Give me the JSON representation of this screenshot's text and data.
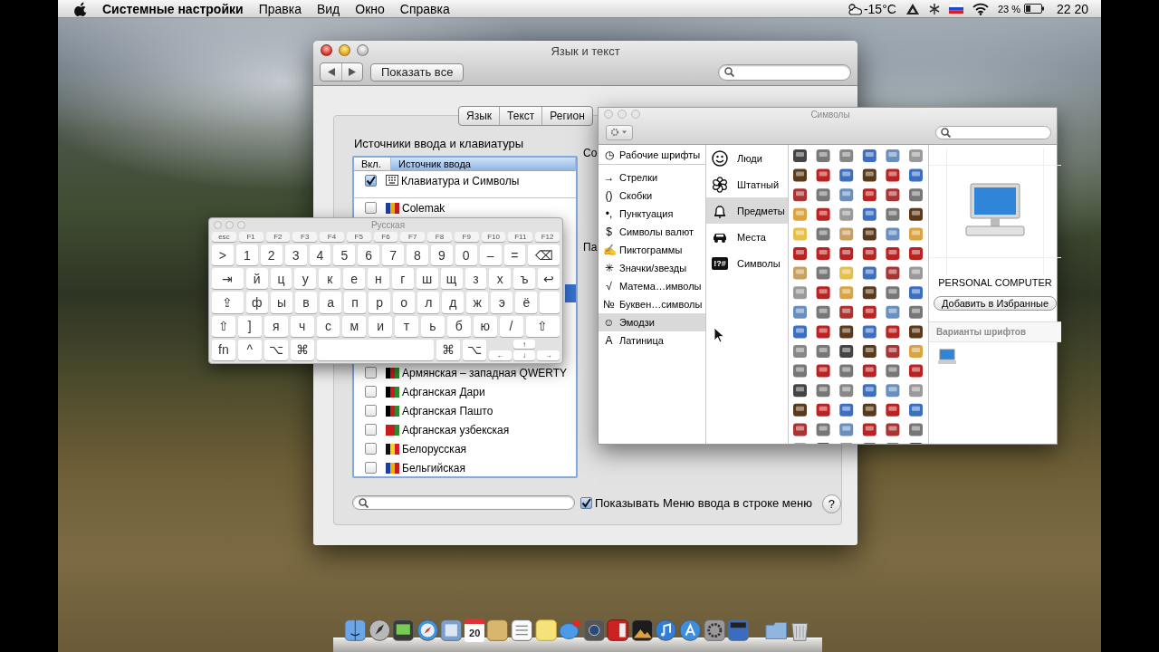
{
  "menubar": {
    "app": "Системные настройки",
    "menus": [
      "Правка",
      "Вид",
      "Окно",
      "Справка"
    ],
    "weather": "-15°C",
    "battery": "23 %",
    "clock": "22 20"
  },
  "prefs": {
    "title": "Язык и текст",
    "show_all": "Показать все",
    "tabs": [
      {
        "label": "Язык",
        "selected": false
      },
      {
        "label": "Текст",
        "selected": false
      },
      {
        "label": "Регион",
        "selected": false
      }
    ],
    "section": "Источники ввода и клавиатуры",
    "columns": [
      {
        "label": "Вкл.",
        "sorted": false
      },
      {
        "label": "Источник ввода",
        "sorted": true
      }
    ],
    "sources": [
      {
        "kind": "viewer",
        "label": "Клавиатура и Символы",
        "checked": true,
        "selected": false
      },
      {
        "kind": "layout",
        "label": "Colemak",
        "checked": false,
        "selected": false
      },
      {
        "kind": "covered",
        "selected": true
      },
      {
        "kind": "layout",
        "label": "Армянская – западная QWERTY",
        "checked": false,
        "selected": false
      },
      {
        "kind": "layout",
        "label": "Афганская Дари",
        "checked": false,
        "selected": false
      },
      {
        "kind": "layout",
        "label": "Афганская Пашто",
        "checked": false,
        "selected": false
      },
      {
        "kind": "layout",
        "label": "Афганская узбекская",
        "checked": false,
        "selected": false
      },
      {
        "kind": "layout",
        "label": "Белорусская",
        "checked": false,
        "selected": false
      },
      {
        "kind": "layout",
        "label": "Бельгийская",
        "checked": false,
        "selected": false
      }
    ],
    "column_2_texts": [
      "Со",
      "Па"
    ],
    "show_menu": {
      "label": "Показывать Меню ввода в строке меню",
      "checked": true
    },
    "help": "?"
  },
  "keyboard": {
    "title": "Русская",
    "rows": [
      [
        {
          "kind": "fn",
          "label": "esc"
        },
        {
          "kind": "fn",
          "label": "F1"
        },
        {
          "kind": "fn",
          "label": "F2"
        },
        {
          "kind": "fn",
          "label": "F3"
        },
        {
          "kind": "fn",
          "label": "F4"
        },
        {
          "kind": "fn",
          "label": "F5"
        },
        {
          "kind": "fn",
          "label": "F6"
        },
        {
          "kind": "fn",
          "label": "F7"
        },
        {
          "kind": "fn",
          "label": "F8"
        },
        {
          "kind": "fn",
          "label": "F9"
        },
        {
          "kind": "fn",
          "label": "F10"
        },
        {
          "kind": "fn",
          "label": "F11"
        },
        {
          "kind": "fn",
          "label": "F12"
        }
      ],
      [
        {
          "kind": "key",
          "label": ">"
        },
        {
          "kind": "key",
          "label": "1"
        },
        {
          "kind": "key",
          "label": "2"
        },
        {
          "kind": "key",
          "label": "3"
        },
        {
          "kind": "key",
          "label": "4"
        },
        {
          "kind": "key",
          "label": "5"
        },
        {
          "kind": "key",
          "label": "6"
        },
        {
          "kind": "key",
          "label": "7"
        },
        {
          "kind": "key",
          "label": "8"
        },
        {
          "kind": "key",
          "label": "9"
        },
        {
          "kind": "key",
          "label": "0"
        },
        {
          "kind": "key",
          "label": "–"
        },
        {
          "kind": "key",
          "label": "="
        },
        {
          "kind": "wide",
          "label": "⌫"
        }
      ],
      [
        {
          "kind": "wide",
          "label": "⇥"
        },
        {
          "kind": "key",
          "label": "й"
        },
        {
          "kind": "key",
          "label": "ц"
        },
        {
          "kind": "key",
          "label": "у"
        },
        {
          "kind": "key",
          "label": "к"
        },
        {
          "kind": "key",
          "label": "е"
        },
        {
          "kind": "key",
          "label": "н"
        },
        {
          "kind": "key",
          "label": "г"
        },
        {
          "kind": "key",
          "label": "ш"
        },
        {
          "kind": "key",
          "label": "щ"
        },
        {
          "kind": "key",
          "label": "з"
        },
        {
          "kind": "key",
          "label": "х"
        },
        {
          "kind": "key",
          "label": "ъ"
        },
        {
          "kind": "key",
          "label": "↩"
        }
      ],
      [
        {
          "kind": "wide",
          "label": "⇪"
        },
        {
          "kind": "key",
          "label": "ф"
        },
        {
          "kind": "key",
          "label": "ы"
        },
        {
          "kind": "key",
          "label": "в"
        },
        {
          "kind": "key",
          "label": "а"
        },
        {
          "kind": "key",
          "label": "п"
        },
        {
          "kind": "key",
          "label": "р"
        },
        {
          "kind": "key",
          "label": "о"
        },
        {
          "kind": "key",
          "label": "л"
        },
        {
          "kind": "key",
          "label": "д"
        },
        {
          "kind": "key",
          "label": "ж"
        },
        {
          "kind": "key",
          "label": "э"
        },
        {
          "kind": "key",
          "label": "ё"
        },
        {
          "kind": "space"
        }
      ],
      [
        {
          "kind": "key",
          "label": "⇧"
        },
        {
          "kind": "key",
          "label": "]"
        },
        {
          "kind": "key",
          "label": "я"
        },
        {
          "kind": "key",
          "label": "ч"
        },
        {
          "kind": "key",
          "label": "с"
        },
        {
          "kind": "key",
          "label": "м"
        },
        {
          "kind": "key",
          "label": "и"
        },
        {
          "kind": "key",
          "label": "т"
        },
        {
          "kind": "key",
          "label": "ь"
        },
        {
          "kind": "key",
          "label": "б"
        },
        {
          "kind": "key",
          "label": "ю"
        },
        {
          "kind": "key",
          "label": "/"
        },
        {
          "kind": "wide",
          "label": "⇧"
        }
      ],
      [
        {
          "kind": "key",
          "label": "fn"
        },
        {
          "kind": "key",
          "label": "^"
        },
        {
          "kind": "key",
          "label": "⌥"
        },
        {
          "kind": "key",
          "label": "⌘"
        },
        {
          "kind": "space"
        },
        {
          "kind": "key",
          "label": "⌘"
        },
        {
          "kind": "key",
          "label": "⌥"
        }
      ]
    ],
    "arrow_keys": [
      "↑",
      "←",
      "↓",
      "→"
    ]
  },
  "chars": {
    "title": "Символы",
    "categories": [
      {
        "glyph": "◷",
        "label": "Рабочие шрифты",
        "selected": false
      },
      {
        "glyph": "→",
        "label": "Стрелки",
        "selected": false
      },
      {
        "glyph": "()",
        "label": "Скобки",
        "selected": false
      },
      {
        "glyph": "•,",
        "label": "Пунктуация",
        "selected": false
      },
      {
        "glyph": "$",
        "label": "Символы валют",
        "selected": false
      },
      {
        "glyph": "✍",
        "label": "Пиктограммы",
        "selected": false
      },
      {
        "glyph": "✳",
        "label": "Значки/звезды",
        "selected": false
      },
      {
        "glyph": "√",
        "label": "Матема…имволы",
        "selected": false
      },
      {
        "glyph": "№",
        "label": "Буквен…символы",
        "selected": false
      },
      {
        "glyph": "☺",
        "label": "Эмодзи",
        "selected": true
      },
      {
        "glyph": "A",
        "label": "Латиница",
        "selected": false
      }
    ],
    "groups": [
      {
        "label": "Люди",
        "selected": false
      },
      {
        "label": "Штатный",
        "selected": false
      },
      {
        "label": "Предметы",
        "selected": true
      },
      {
        "label": "Места",
        "selected": false
      },
      {
        "label": "Символы",
        "icon_text": "!?#",
        "selected": false
      }
    ],
    "character_name": "PERSONAL COMPUTER",
    "add_favorite": "Добавить в Избранные",
    "variants_title": "Варианты шрифтов"
  },
  "dock": {
    "calendar_date": "20"
  }
}
